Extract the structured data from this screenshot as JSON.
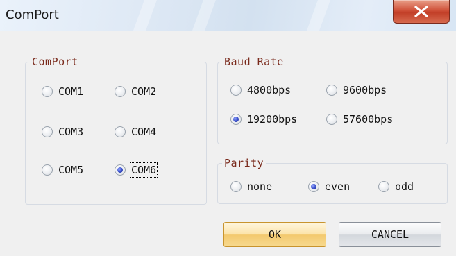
{
  "window": {
    "title": "ComPort",
    "close_icon": "close-x-icon"
  },
  "comport_group": {
    "legend": "ComPort",
    "options": [
      {
        "label": "COM1",
        "checked": false
      },
      {
        "label": "COM2",
        "checked": false
      },
      {
        "label": "COM3",
        "checked": false
      },
      {
        "label": "COM4",
        "checked": false
      },
      {
        "label": "COM5",
        "checked": false
      },
      {
        "label": "COM6",
        "checked": true
      }
    ]
  },
  "baud_group": {
    "legend": "Baud Rate",
    "options": [
      {
        "label": "4800bps",
        "checked": false
      },
      {
        "label": "9600bps",
        "checked": false
      },
      {
        "label": "19200bps",
        "checked": true
      },
      {
        "label": "57600bps",
        "checked": false
      }
    ]
  },
  "parity_group": {
    "legend": "Parity",
    "options": [
      {
        "label": "none",
        "checked": false
      },
      {
        "label": "even",
        "checked": true
      },
      {
        "label": "odd",
        "checked": false
      }
    ]
  },
  "buttons": {
    "ok": "OK",
    "cancel": "CANCEL"
  },
  "colors": {
    "legend_text": "#7a2a1c",
    "radio_selected": "#3a4fc8",
    "close_button": "#c94a32",
    "ok_button": "#f7d98f"
  }
}
